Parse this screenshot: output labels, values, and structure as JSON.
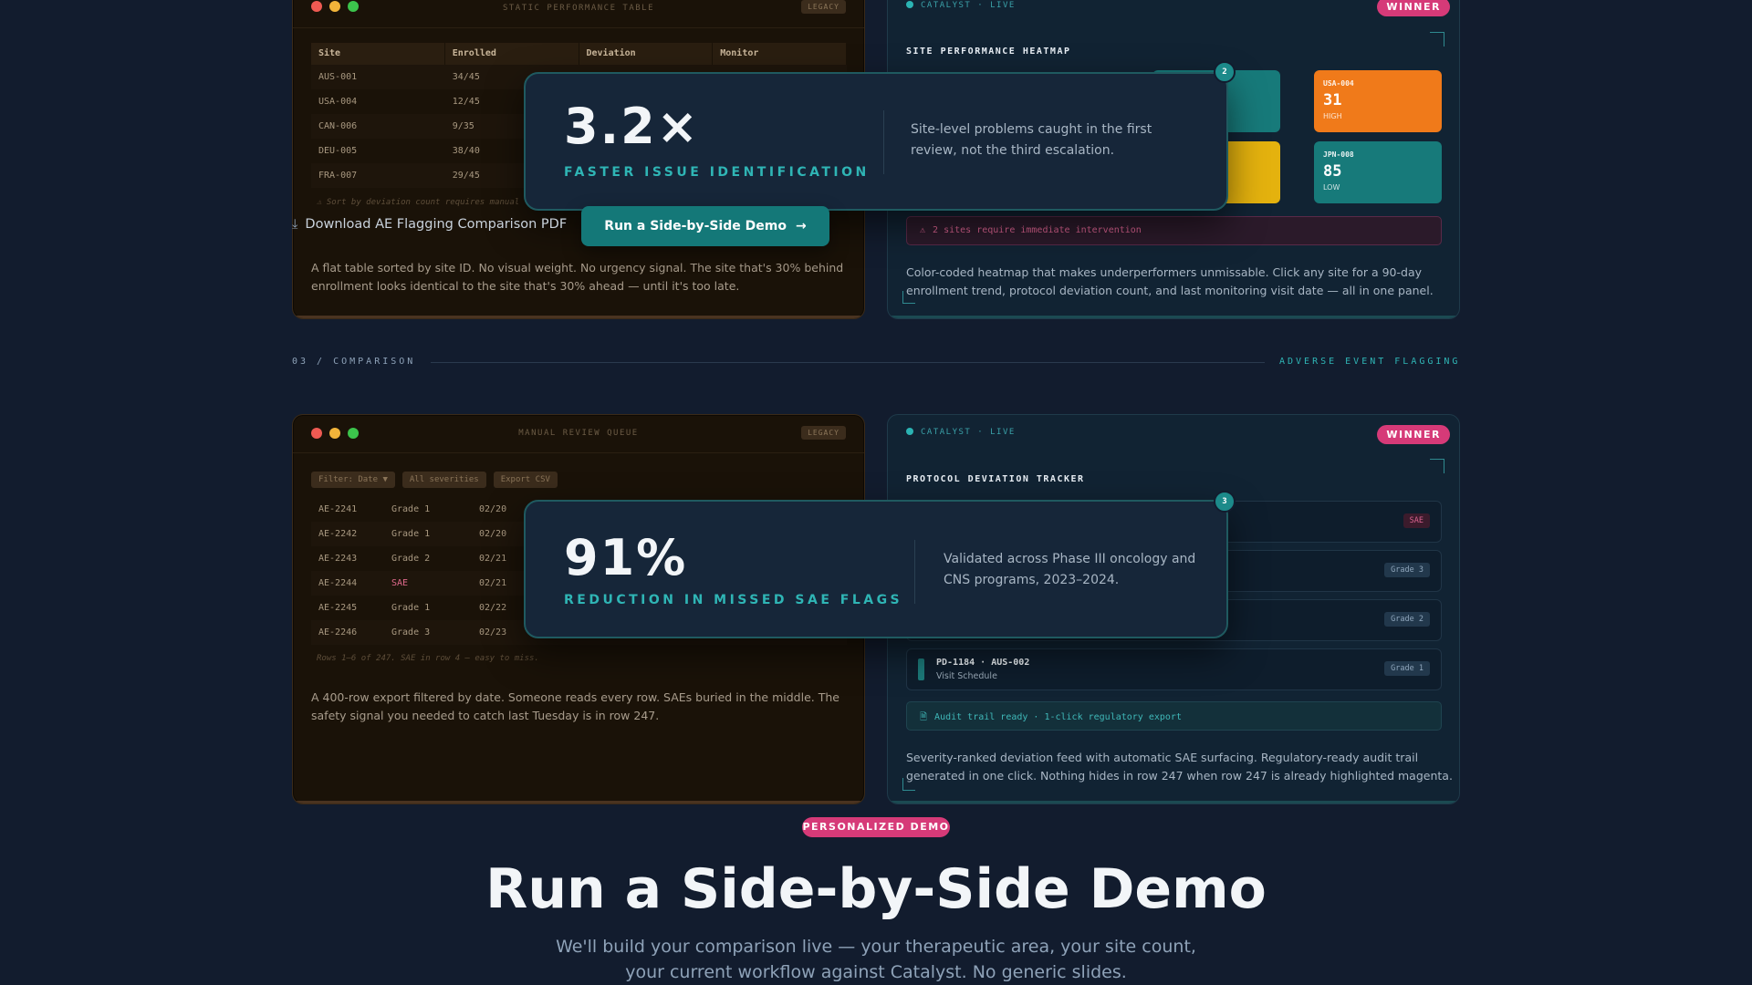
{
  "top_legacy": {
    "title": "STATIC PERFORMANCE TABLE",
    "badge": "LEGACY",
    "columns": [
      "Site",
      "Enrolled",
      "Deviation",
      "Monitor"
    ],
    "rows": [
      [
        "AUS-001",
        "34/45",
        "",
        ""
      ],
      [
        "USA-004",
        "12/45",
        "",
        ""
      ],
      [
        "CAN-006",
        "9/35",
        "",
        ""
      ],
      [
        "DEU-005",
        "38/40",
        "",
        ""
      ],
      [
        "FRA-007",
        "29/45",
        "",
        ""
      ]
    ],
    "note": "⚠ Sort by deviation count requires manual",
    "description": "A flat table sorted by site ID. No visual weight. No urgency signal. The site that's 30% behind enrollment looks identical to the site that's 30% ahead — until it's too late."
  },
  "top_catalyst": {
    "live": "CATALYST · LIVE",
    "winner": "WINNER",
    "section_title": "SITE PERFORMANCE HEATMAP",
    "tiles": [
      {
        "id": "USA-004",
        "value": "31",
        "level": "HIGH",
        "color": "#f07a1a"
      },
      {
        "id": "JPN-008",
        "value": "85",
        "level": "LOW",
        "color": "#177a7a"
      }
    ],
    "tile_colors": {
      "teal": "#177a7a",
      "yellow": "#e4b20e",
      "orange": "#f07a1a"
    },
    "alert": "2 sites require immediate intervention",
    "description": "Color-coded heatmap that makes underperformers unmissable. Click any site for a 90-day enrollment trend, protocol deviation count, and last monitoring visit date — all in one panel."
  },
  "stat1": {
    "step": "2",
    "value": "3.2×",
    "caption": "FASTER ISSUE IDENTIFICATION",
    "description": "Site-level problems caught in the first review, not the third escalation."
  },
  "download_link": "Download AE Flagging Comparison PDF",
  "demo_button": "Run a Side-by-Side Demo",
  "section": {
    "left": "03 / COMPARISON",
    "right": "ADVERSE EVENT FLAGGING"
  },
  "bottom_legacy": {
    "title": "MANUAL REVIEW QUEUE",
    "badge": "LEGACY",
    "chips": [
      "Filter: Date ▼",
      "All severities",
      "Export CSV"
    ],
    "rows": [
      [
        "AE-2241",
        "Grade 1",
        "02/20"
      ],
      [
        "AE-2242",
        "Grade 1",
        "02/20"
      ],
      [
        "AE-2243",
        "Grade 2",
        "02/21"
      ],
      [
        "AE-2244",
        "SAE",
        "02/21"
      ],
      [
        "AE-2245",
        "Grade 1",
        "02/22"
      ],
      [
        "AE-2246",
        "Grade 3",
        "02/23"
      ]
    ],
    "note": "Rows 1–6 of 247. SAE in row 4 — easy to miss.",
    "description": "A 400-row export filtered by date. Someone reads every row. SAEs buried in the middle. The safety signal you needed to catch last Tuesday is in row 247."
  },
  "bottom_catalyst": {
    "live": "CATALYST · LIVE",
    "winner": "WINNER",
    "section_title": "PROTOCOL DEVIATION TRACKER",
    "rows": [
      {
        "id": "",
        "category": "",
        "grade": "SAE"
      },
      {
        "id": "",
        "category": "",
        "grade": "Grade 3"
      },
      {
        "id": "",
        "category": "",
        "grade": "Grade 2"
      },
      {
        "id": "PD-1184 · AUS-002",
        "category": "Visit Schedule",
        "grade": "Grade 1"
      }
    ],
    "audit": "Audit trail ready · 1-click regulatory export",
    "description": "Severity-ranked deviation feed with automatic SAE surfacing. Regulatory-ready audit trail generated in one click. Nothing hides in row 247 when row 247 is already highlighted magenta."
  },
  "stat2": {
    "step": "3",
    "value": "91%",
    "caption": "REDUCTION IN MISSED SAE FLAGS",
    "description": "Validated across Phase III oncology and CNS programs, 2023–2024."
  },
  "cta": {
    "pill": "PERSONALIZED DEMO",
    "headline": "Run a Side-by-Side Demo",
    "sub_line1": "We'll build your comparison live — your therapeutic area, your site count,",
    "sub_line2": "your current workflow against Catalyst. No generic slides."
  },
  "colors": {
    "accent_teal": "#2fb5b5",
    "magenta": "#d63a78",
    "button": "#147878"
  }
}
